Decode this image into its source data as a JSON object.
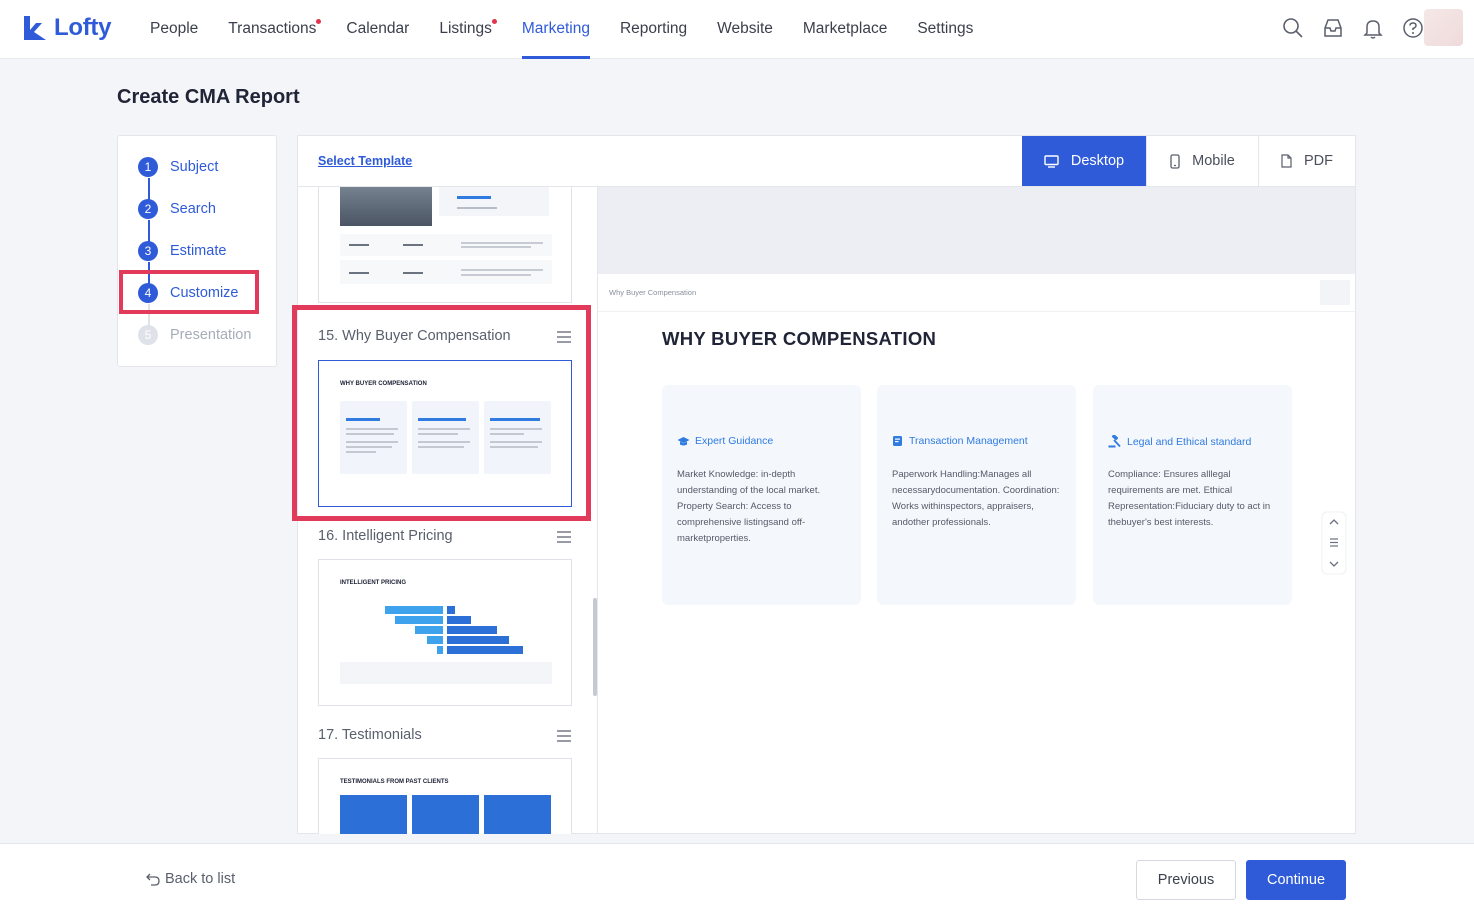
{
  "app": {
    "name": "Lofty"
  },
  "nav": {
    "items": [
      {
        "label": "People"
      },
      {
        "label": "Transactions",
        "dot": true
      },
      {
        "label": "Calendar"
      },
      {
        "label": "Listings",
        "dot": true
      },
      {
        "label": "Marketing",
        "active": true
      },
      {
        "label": "Reporting"
      },
      {
        "label": "Website"
      },
      {
        "label": "Marketplace"
      },
      {
        "label": "Settings"
      }
    ]
  },
  "page": {
    "title": "Create CMA Report"
  },
  "steps": [
    {
      "num": "1",
      "label": "Subject"
    },
    {
      "num": "2",
      "label": "Search"
    },
    {
      "num": "3",
      "label": "Estimate"
    },
    {
      "num": "4",
      "label": "Customize",
      "current": true
    },
    {
      "num": "5",
      "label": "Presentation",
      "disabled": true
    }
  ],
  "toolbar": {
    "select_template": "Select Template",
    "views": {
      "desktop": "Desktop",
      "mobile": "Mobile",
      "pdf": "PDF"
    }
  },
  "slides": [
    {
      "title": "15. Why Buyer Compensation",
      "thumb_heading": "WHY BUYER COMPENSATION",
      "selected": true
    },
    {
      "title": "16. Intelligent Pricing",
      "thumb_heading": "INTELLIGENT PRICING"
    },
    {
      "title": "17. Testimonials",
      "thumb_heading": "TESTIMONIALS FROM PAST CLIENTS"
    }
  ],
  "preview": {
    "header": "Why Buyer Compensation",
    "heading": "WHY BUYER COMPENSATION",
    "cards": [
      {
        "title": "Expert Guidance",
        "icon": "graduation-cap-icon",
        "body": "Market Knowledge: in-depth understanding of the local market. Property Search: Access to comprehensive listingsand off-marketproperties."
      },
      {
        "title": "Transaction Management",
        "icon": "document-icon",
        "body": "Paperwork Handling:Manages all necessarydocumentation. Coordination: Works withinspectors, appraisers, andother professionals."
      },
      {
        "title": "Legal and Ethical standard",
        "icon": "gavel-icon",
        "body": "Compliance: Ensures alllegal requirements are met. Ethical Representation:Fiduciary duty to act in thebuyer's best interests."
      }
    ]
  },
  "footer": {
    "back": "Back to list",
    "previous": "Previous",
    "continue": "Continue"
  },
  "colors": {
    "accent": "#2f5bd9",
    "highlight": "#e23a5a"
  }
}
